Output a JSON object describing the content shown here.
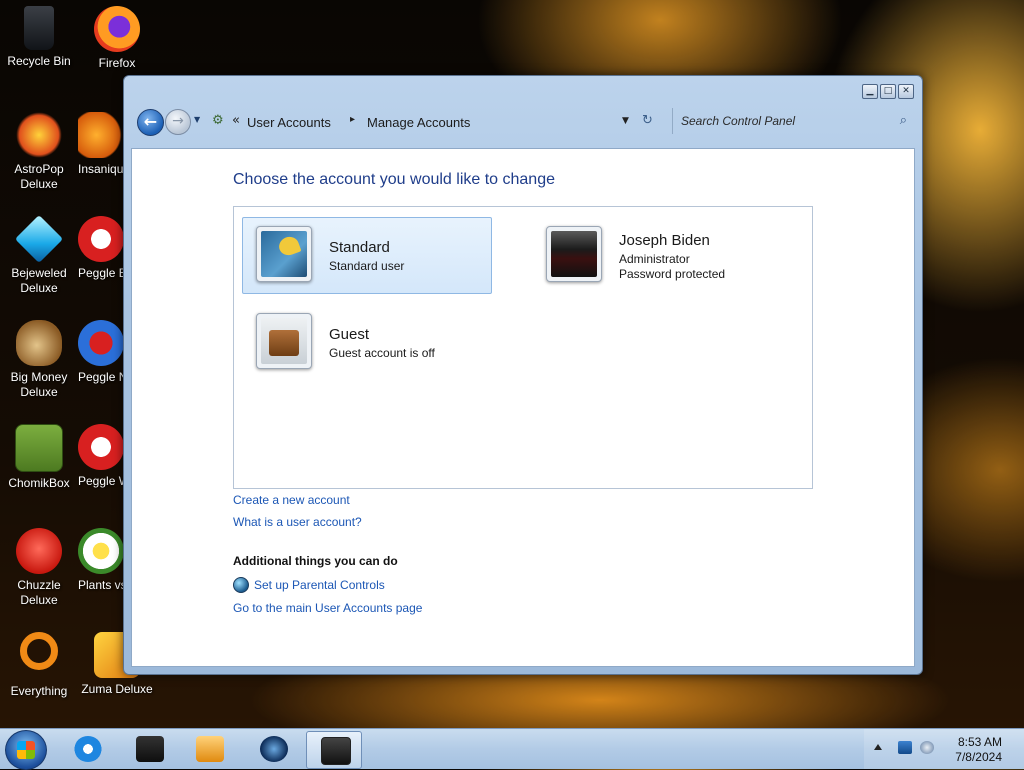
{
  "desktop": {
    "icons": [
      {
        "label": "Recycle Bin"
      },
      {
        "label": "Firefox"
      },
      {
        "label": "AstroPop Deluxe"
      },
      {
        "label": "Insaniquarium Deluxe"
      },
      {
        "label": "Bejeweled Deluxe"
      },
      {
        "label": "Peggle Extreme"
      },
      {
        "label": "Big Money Deluxe"
      },
      {
        "label": "Peggle Nights Deluxe"
      },
      {
        "label": "ChomikBox"
      },
      {
        "label": "Peggle World of Warcraft"
      },
      {
        "label": "Chuzzle Deluxe"
      },
      {
        "label": "Plants vs. Zombies"
      },
      {
        "label": "Everything"
      },
      {
        "label": "Zuma Deluxe"
      }
    ]
  },
  "window": {
    "breadcrumb": [
      "User Accounts",
      "Manage Accounts"
    ],
    "breadcrumb_chevron": "«",
    "breadcrumb_separator": "▸",
    "search_placeholder": "Search Control Panel",
    "heading": "Choose the account you would like to change",
    "accounts": [
      {
        "name": "Standard",
        "desc": "Standard user",
        "selected": true
      },
      {
        "name": "Joseph Biden",
        "desc": "Administrator",
        "desc2": "Password protected",
        "selected": false
      },
      {
        "name": "Guest",
        "desc": "Guest account is off",
        "selected": false
      }
    ],
    "links": {
      "create": "Create a new account",
      "what_is": "What is a user account?",
      "additional_title": "Additional things you can do",
      "parental": "Set up Parental Controls",
      "main_page": "Go to the main User Accounts page"
    }
  },
  "taskbar": {
    "time": "8:53 AM",
    "date": "7/8/2024"
  },
  "colors": {
    "link": "#1c57b5",
    "heading": "#1f3d8a",
    "selected_bg": "#d4e7fa"
  }
}
